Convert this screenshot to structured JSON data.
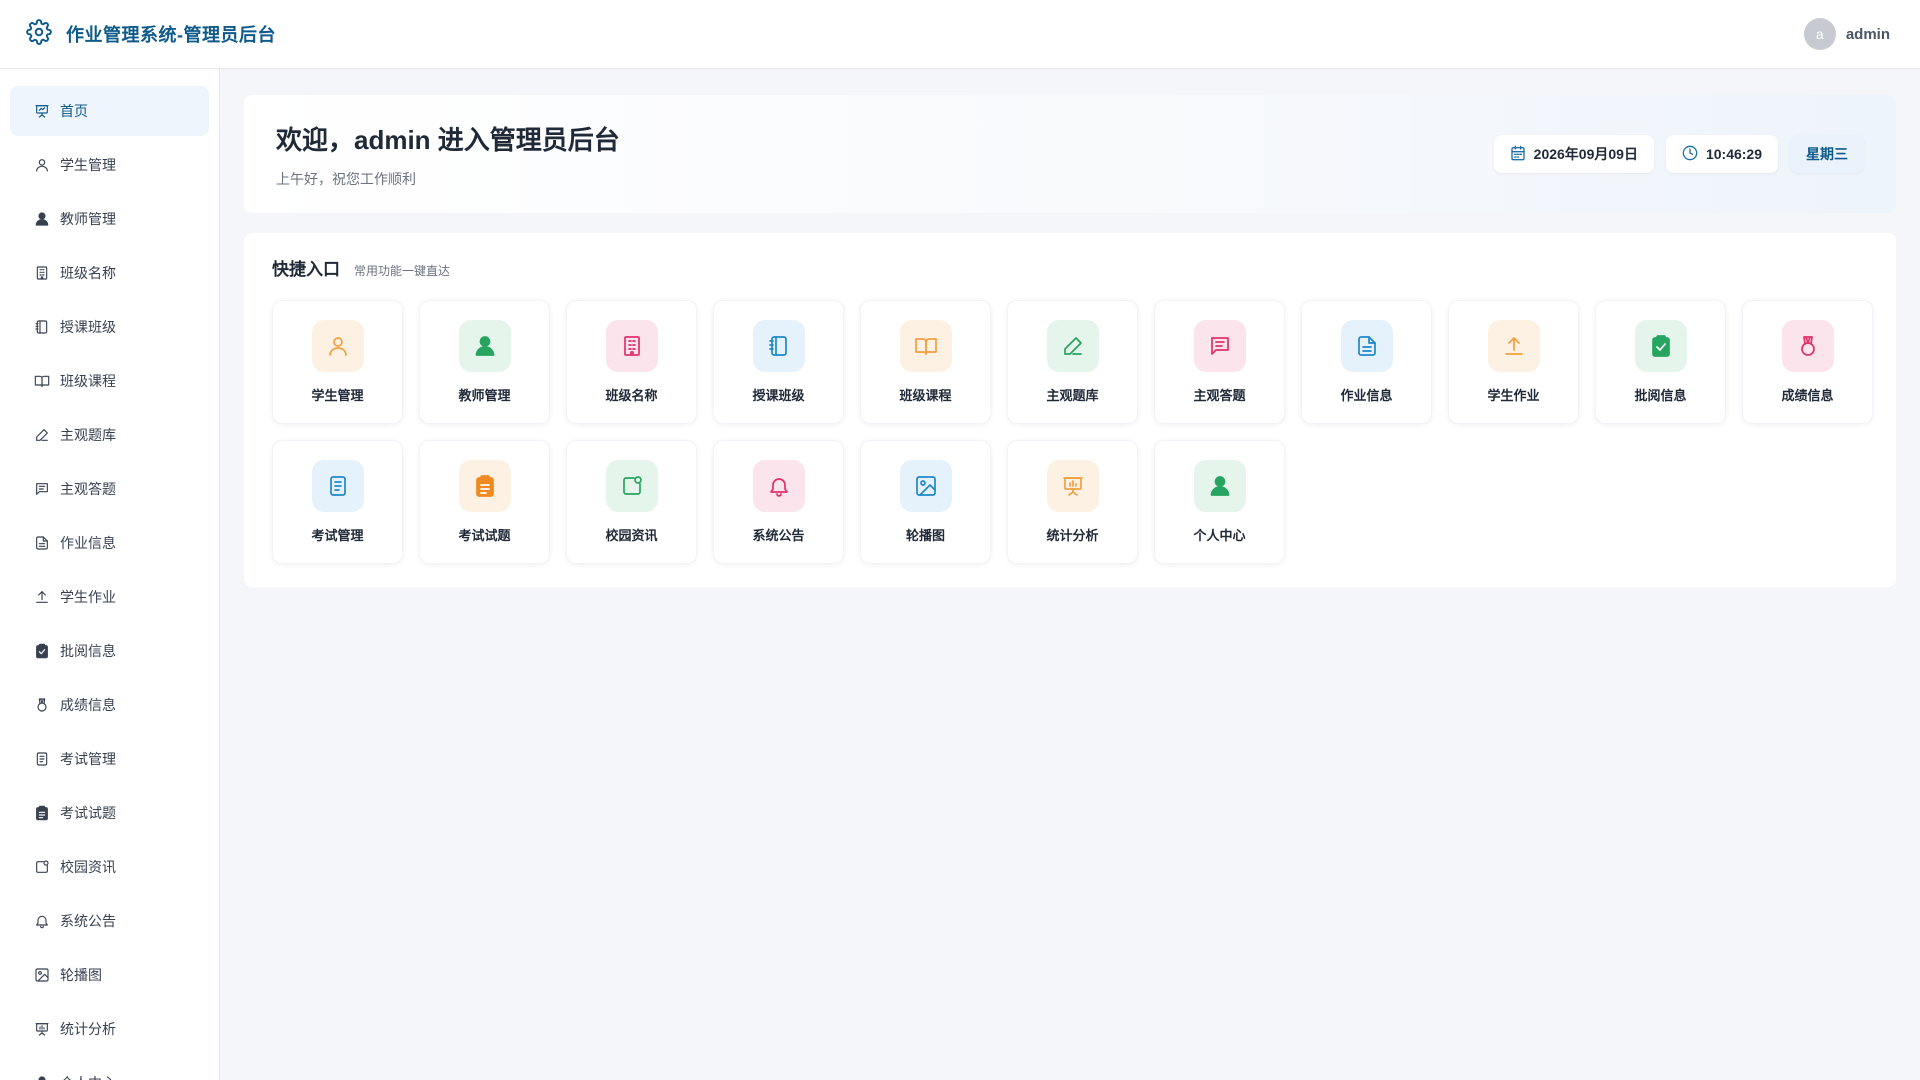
{
  "header": {
    "title": "作业管理系统-管理员后台",
    "avatar_letter": "a",
    "username": "admin"
  },
  "sidebar": {
    "items": [
      {
        "label": "首页",
        "icon": "presentation-icon",
        "active": true
      },
      {
        "label": "学生管理",
        "icon": "user-icon"
      },
      {
        "label": "教师管理",
        "icon": "user-filled-icon"
      },
      {
        "label": "班级名称",
        "icon": "building-icon"
      },
      {
        "label": "授课班级",
        "icon": "notebook-icon"
      },
      {
        "label": "班级课程",
        "icon": "book-open-icon"
      },
      {
        "label": "主观题库",
        "icon": "pen-icon"
      },
      {
        "label": "主观答题",
        "icon": "message-icon"
      },
      {
        "label": "作业信息",
        "icon": "document-icon"
      },
      {
        "label": "学生作业",
        "icon": "upload-icon"
      },
      {
        "label": "批阅信息",
        "icon": "clipboard-check-icon"
      },
      {
        "label": "成绩信息",
        "icon": "medal-icon"
      },
      {
        "label": "考试管理",
        "icon": "list-doc-icon"
      },
      {
        "label": "考试试题",
        "icon": "clipboard-icon"
      },
      {
        "label": "校园资讯",
        "icon": "news-icon"
      },
      {
        "label": "系统公告",
        "icon": "bell-icon"
      },
      {
        "label": "轮播图",
        "icon": "image-icon"
      },
      {
        "label": "统计分析",
        "icon": "chart-board-icon"
      },
      {
        "label": "个人中心",
        "icon": "user-filled-icon"
      }
    ]
  },
  "welcome": {
    "title": "欢迎，admin 进入管理员后台",
    "subtitle": "上午好，祝您工作顺利",
    "date": "2026年09月09日",
    "time": "10:46:29",
    "weekday": "星期三"
  },
  "quick": {
    "title": "快捷入口",
    "subtitle": "常用功能一键直达",
    "items": [
      {
        "label": "学生管理",
        "icon": "user-icon",
        "color": "#f0a040",
        "bg": "#fdf1e3"
      },
      {
        "label": "教师管理",
        "icon": "user-filled-icon",
        "color": "#27a560",
        "bg": "#e6f5ec"
      },
      {
        "label": "班级名称",
        "icon": "building-icon",
        "color": "#e0306c",
        "bg": "#fce4ec"
      },
      {
        "label": "授课班级",
        "icon": "notebook-icon",
        "color": "#1e88c8",
        "bg": "#e6f2fb"
      },
      {
        "label": "班级课程",
        "icon": "book-open-icon",
        "color": "#f0a040",
        "bg": "#fdf1e3"
      },
      {
        "label": "主观题库",
        "icon": "pen-icon",
        "color": "#27a560",
        "bg": "#e6f5ec"
      },
      {
        "label": "主观答题",
        "icon": "message-icon",
        "color": "#e0306c",
        "bg": "#fce4ec"
      },
      {
        "label": "作业信息",
        "icon": "document-icon",
        "color": "#1e88c8",
        "bg": "#e6f2fb"
      },
      {
        "label": "学生作业",
        "icon": "upload-icon",
        "color": "#f0a040",
        "bg": "#fdf1e3"
      },
      {
        "label": "批阅信息",
        "icon": "clipboard-check-icon",
        "color": "#27a560",
        "bg": "#e6f5ec"
      },
      {
        "label": "成绩信息",
        "icon": "medal-icon",
        "color": "#e0306c",
        "bg": "#fce4ec"
      },
      {
        "label": "考试管理",
        "icon": "list-doc-icon",
        "color": "#1e88c8",
        "bg": "#e6f2fb"
      },
      {
        "label": "考试试题",
        "icon": "clipboard-icon",
        "color": "#f08a20",
        "bg": "#fdf1e3"
      },
      {
        "label": "校园资讯",
        "icon": "news-icon",
        "color": "#27a560",
        "bg": "#e6f5ec"
      },
      {
        "label": "系统公告",
        "icon": "bell-icon",
        "color": "#e0306c",
        "bg": "#fce4ec"
      },
      {
        "label": "轮播图",
        "icon": "image-icon",
        "color": "#1e88c8",
        "bg": "#e6f2fb"
      },
      {
        "label": "统计分析",
        "icon": "chart-board-icon",
        "color": "#f0a040",
        "bg": "#fdf1e3"
      },
      {
        "label": "个人中心",
        "icon": "user-filled-icon",
        "color": "#27a560",
        "bg": "#e6f5ec"
      }
    ]
  }
}
